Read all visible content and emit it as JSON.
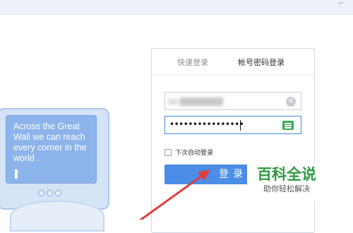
{
  "colors": {
    "accent": "#4b8de7",
    "focus_border": "#3f8ae0",
    "watermark_green": "#2e9a40",
    "arrow_red": "#e03b3b"
  },
  "illustration": {
    "screen_text": "Across the Great Wall we can reach every corner in the world ."
  },
  "login": {
    "tabs": [
      {
        "label": "快速登录",
        "active": false
      },
      {
        "label": "帐号密码登录",
        "active": true
      }
    ],
    "username": {
      "value": "",
      "clear_icon": "close-circle-icon"
    },
    "password": {
      "masked_value": "••••••••••••••••",
      "keyboard_icon": "virtual-keyboard-icon"
    },
    "auto_login_label": "下次自动登录",
    "submit_label": "登录"
  },
  "watermark": {
    "title": "百科全说",
    "subtitle": "助你轻松解决"
  }
}
